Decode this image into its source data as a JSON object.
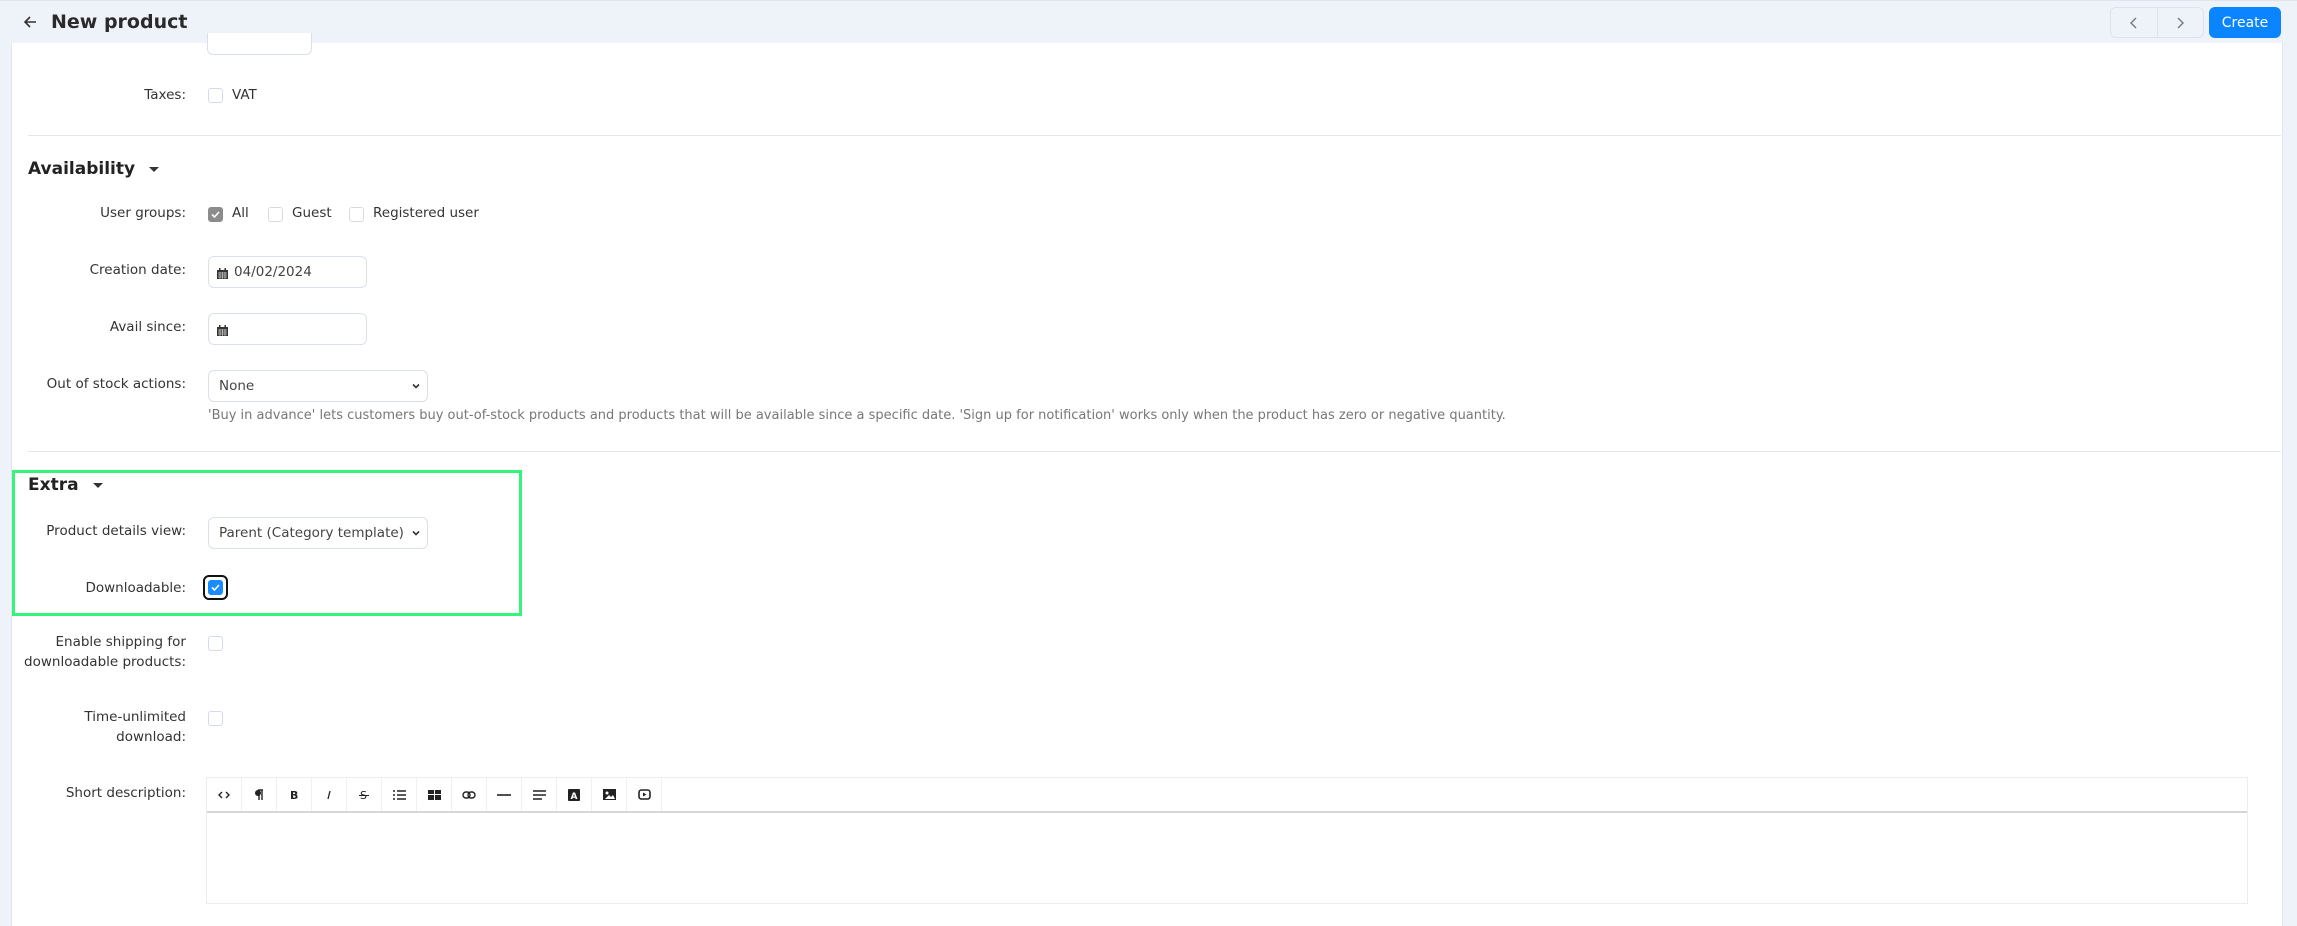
{
  "header": {
    "title": "New product",
    "back_icon": "arrow-left-icon",
    "prev_icon": "chevron-left-icon",
    "next_icon": "chevron-right-icon",
    "create_label": "Create",
    "accent_color": "#0a84ff"
  },
  "taxes": {
    "label": "Taxes:",
    "options": [
      {
        "label": "VAT",
        "checked": false
      }
    ]
  },
  "availability": {
    "title": "Availability",
    "user_groups": {
      "label": "User groups:",
      "options": [
        {
          "label": "All",
          "checked": true
        },
        {
          "label": "Guest",
          "checked": false
        },
        {
          "label": "Registered user",
          "checked": false
        }
      ]
    },
    "creation_date": {
      "label": "Creation date:",
      "value": "04/02/2024",
      "icon": "calendar-icon"
    },
    "avail_since": {
      "label": "Avail since:",
      "value": "",
      "icon": "calendar-icon"
    },
    "out_of_stock": {
      "label": "Out of stock actions:",
      "selected": "None",
      "help": "'Buy in advance' lets customers buy out-of-stock products and products that will be available since a specific date. 'Sign up for notification' works only when the product has zero or negative quantity."
    }
  },
  "extra": {
    "title": "Extra",
    "product_details_view": {
      "label": "Product details view:",
      "selected": "Parent (Category template)"
    },
    "downloadable": {
      "label": "Downloadable:",
      "checked": true
    },
    "enable_shipping": {
      "label_line1": "Enable shipping for",
      "label_line2": "downloadable products:",
      "checked": false
    },
    "time_unlimited": {
      "label_line1": "Time-unlimited",
      "label_line2": "download:",
      "checked": false
    },
    "short_description": {
      "label": "Short description:",
      "value": "",
      "toolbar": [
        "html-code-icon",
        "paragraph-icon",
        "bold-icon",
        "italic-icon",
        "strikethrough-icon",
        "unordered-list-icon",
        "table-icon",
        "link-icon",
        "horizontal-rule-icon",
        "align-icon",
        "font-color-icon",
        "image-icon",
        "video-icon"
      ]
    }
  },
  "highlight_color": "#34f57a"
}
